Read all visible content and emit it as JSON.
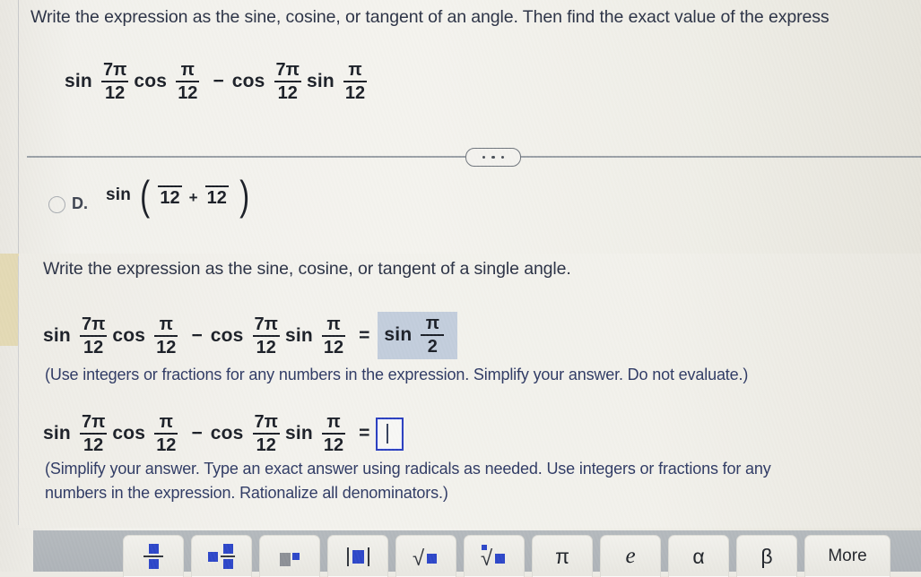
{
  "problem": {
    "prompt_top": "Write the expression as the sine, cosine, or tangent of an angle. Then find the exact value of the express",
    "prompt_mid": "Write the expression as the sine, cosine, or tangent of a single angle."
  },
  "expression": {
    "fn1": "sin",
    "frac1": {
      "num": "7π",
      "den": "12"
    },
    "fn2": "cos",
    "frac2": {
      "num": "π",
      "den": "12"
    },
    "minus": "−",
    "fn3": "cos",
    "frac3": {
      "num": "7π",
      "den": "12"
    },
    "fn4": "sin",
    "frac4": {
      "num": "π",
      "den": "12"
    },
    "equals": "="
  },
  "option_d": {
    "letter": "D.",
    "fn": "sin",
    "open_paren": "(",
    "frac_left": {
      "num": "",
      "den": "12"
    },
    "plus": "+",
    "frac_right": {
      "num": "",
      "den": "12"
    },
    "close_paren": ")"
  },
  "answer_filled": {
    "fn": "sin",
    "frac": {
      "num": "π",
      "den": "2"
    },
    "highlight_color": "#c2cddc"
  },
  "answer_empty": {
    "value": "",
    "border_color": "#2b3fbf"
  },
  "hints": {
    "hint1": "(Use integers or fractions for any numbers in the expression. Simplify your answer. Do not evaluate.)",
    "hint2_line1": "(Simplify your answer. Type an exact answer using radicals as needed. Use integers or fractions for any",
    "hint2_line2": "numbers in the expression. Rationalize all denominators.)"
  },
  "keyboard": {
    "keys": [
      {
        "name": "fraction",
        "label": ""
      },
      {
        "name": "mixed-number",
        "label": ""
      },
      {
        "name": "exponent",
        "label": ""
      },
      {
        "name": "absolute-value",
        "label": ""
      },
      {
        "name": "square-root",
        "label": ""
      },
      {
        "name": "nth-root",
        "label": ""
      },
      {
        "name": "pi",
        "label": "π"
      },
      {
        "name": "e",
        "label": "e"
      },
      {
        "name": "alpha",
        "label": "α"
      },
      {
        "name": "beta",
        "label": "β"
      },
      {
        "name": "more",
        "label": "More"
      }
    ]
  }
}
